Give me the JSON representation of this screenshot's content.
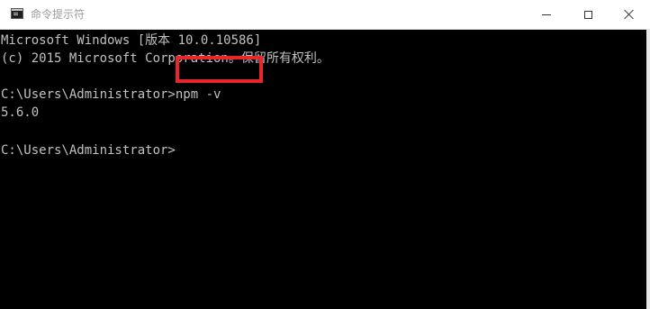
{
  "window": {
    "title": "命令提示符",
    "icon": "cmd-icon"
  },
  "controls": {
    "minimize": "minimize-icon",
    "maximize": "maximize-icon",
    "close": "close-icon"
  },
  "console": {
    "lines": [
      "Microsoft Windows [版本 10.0.10586]",
      "(c) 2015 Microsoft Corporation。保留所有权利。",
      "C:\\Users\\Administrator>npm -v",
      "5.6.0",
      "C:\\Users\\Administrator>"
    ]
  },
  "colors": {
    "console_bg": "#000000",
    "console_text": "#c0c0c0",
    "highlight": "#e8262c"
  }
}
